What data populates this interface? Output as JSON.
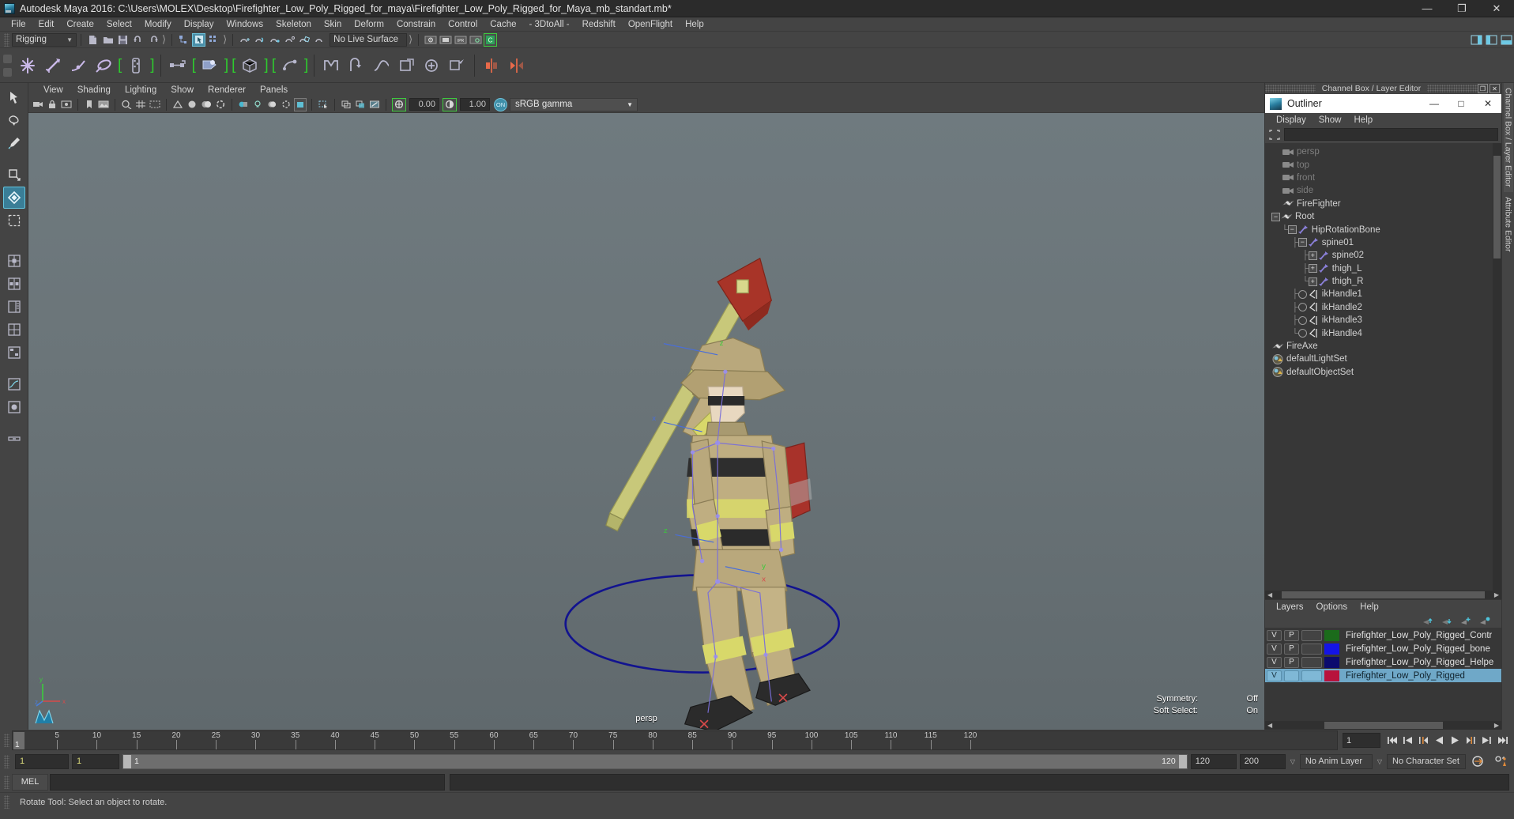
{
  "window": {
    "title": "Autodesk Maya 2016: C:\\Users\\MOLEX\\Desktop\\Firefighter_Low_Poly_Rigged_for_maya\\Firefighter_Low_Poly_Rigged_for_Maya_mb_standart.mb*",
    "minimize": "—",
    "maximize": "❐",
    "close": "✕"
  },
  "menubar": [
    "File",
    "Edit",
    "Create",
    "Select",
    "Modify",
    "Display",
    "Windows",
    "Skeleton",
    "Skin",
    "Deform",
    "Constrain",
    "Control",
    "Cache",
    "- 3DtoAll -",
    "Redshift",
    "OpenFlight",
    "Help"
  ],
  "toolbar": {
    "menuset": "Rigging",
    "live_surface": "No Live Surface"
  },
  "viewport_panel_menu": [
    "View",
    "Shading",
    "Lighting",
    "Show",
    "Renderer",
    "Panels"
  ],
  "viewport_toolbar": {
    "exposure_value": "0.00",
    "gamma_value": "1.00",
    "color_mode": "sRGB gamma",
    "color_mode_on": "ON"
  },
  "viewport": {
    "camera_label": "persp",
    "hud": [
      {
        "label": "Symmetry:",
        "value": "Off"
      },
      {
        "label": "Soft Select:",
        "value": "On"
      }
    ],
    "axis": {
      "x": "x",
      "y": "y",
      "z": "z"
    }
  },
  "channelbox_bar": {
    "title": "Channel Box / Layer Editor",
    "restore": "❐",
    "close": "✕"
  },
  "outliner": {
    "title": "Outliner",
    "minimize": "—",
    "maximize": "□",
    "close": "✕",
    "menu": [
      "Display",
      "Show",
      "Help"
    ],
    "search_value": "",
    "search_placeholder": "",
    "items": [
      {
        "label": "persp",
        "indent": 1,
        "icon": "camera-icon",
        "dim": true,
        "expander": "none",
        "line": "none"
      },
      {
        "label": "top",
        "indent": 1,
        "icon": "camera-icon",
        "dim": true,
        "expander": "none",
        "line": "none"
      },
      {
        "label": "front",
        "indent": 1,
        "icon": "camera-icon",
        "dim": true,
        "expander": "none",
        "line": "none"
      },
      {
        "label": "side",
        "indent": 1,
        "icon": "camera-icon",
        "dim": true,
        "expander": "none",
        "line": "none"
      },
      {
        "label": "FireFighter",
        "indent": 1,
        "icon": "mesh-icon",
        "dim": false,
        "expander": "none",
        "line": "none"
      },
      {
        "label": "Root",
        "indent": 0,
        "icon": "mesh-icon",
        "dim": false,
        "expander": "minus",
        "line": "none"
      },
      {
        "label": "HipRotationBone",
        "indent": 1,
        "icon": "joint-icon",
        "dim": false,
        "expander": "minus",
        "line": "corner"
      },
      {
        "label": "spine01",
        "indent": 2,
        "icon": "joint-icon",
        "dim": false,
        "expander": "minus",
        "line": "tee"
      },
      {
        "label": "spine02",
        "indent": 3,
        "icon": "joint-icon",
        "dim": false,
        "expander": "plus",
        "line": "tee"
      },
      {
        "label": "thigh_L",
        "indent": 3,
        "icon": "joint-icon",
        "dim": false,
        "expander": "plus",
        "line": "tee"
      },
      {
        "label": "thigh_R",
        "indent": 3,
        "icon": "joint-icon",
        "dim": false,
        "expander": "plus",
        "line": "corner"
      },
      {
        "label": "ikHandle1",
        "indent": 2,
        "icon": "ikhandle-icon",
        "dim": false,
        "expander": "dot",
        "line": "tee"
      },
      {
        "label": "ikHandle2",
        "indent": 2,
        "icon": "ikhandle-icon",
        "dim": false,
        "expander": "dot",
        "line": "tee"
      },
      {
        "label": "ikHandle3",
        "indent": 2,
        "icon": "ikhandle-icon",
        "dim": false,
        "expander": "dot",
        "line": "tee"
      },
      {
        "label": "ikHandle4",
        "indent": 2,
        "icon": "ikhandle-icon",
        "dim": false,
        "expander": "dot",
        "line": "corner"
      },
      {
        "label": "FireAxe",
        "indent": 0,
        "icon": "mesh-icon",
        "dim": false,
        "expander": "none",
        "line": "none"
      },
      {
        "label": "defaultLightSet",
        "indent": 0,
        "icon": "set-icon",
        "dim": false,
        "expander": "none",
        "line": "none"
      },
      {
        "label": "defaultObjectSet",
        "indent": 0,
        "icon": "set-icon",
        "dim": false,
        "expander": "none",
        "line": "none"
      }
    ]
  },
  "layer_editor": {
    "menu": [
      "Layers",
      "Options",
      "Help"
    ],
    "layers": [
      {
        "visibility": "V",
        "playback": "P",
        "third": "",
        "color": "#1b6b1b",
        "name": "Firefighter_Low_Poly_Rigged_Contr",
        "selected": false
      },
      {
        "visibility": "V",
        "playback": "P",
        "third": "",
        "color": "#1414e6",
        "name": "Firefighter_Low_Poly_Rigged_bone",
        "selected": false
      },
      {
        "visibility": "V",
        "playback": "P",
        "third": "",
        "color": "#0b0b6e",
        "name": "Firefighter_Low_Poly_Rigged_Helpe",
        "selected": false
      },
      {
        "visibility": "V",
        "playback": "",
        "third": "",
        "color": "#b8123c",
        "name": "Firefighter_Low_Poly_Rigged",
        "selected": true
      }
    ]
  },
  "side_tabs": [
    {
      "label": "Channel Box / Layer Editor",
      "active": true
    },
    {
      "label": "Attribute Editor",
      "active": false
    }
  ],
  "timeline": {
    "ticks": [
      5,
      10,
      15,
      20,
      25,
      30,
      35,
      40,
      45,
      50,
      55,
      60,
      65,
      70,
      75,
      80,
      85,
      90,
      95,
      100,
      105,
      110,
      115,
      120
    ],
    "start": 1,
    "end": 120,
    "current_frame": "1",
    "current_frame_field": "1"
  },
  "range": {
    "anim_start": "1",
    "anim_end": "1",
    "range_start": "1",
    "range_end": "120",
    "playback_end": "120",
    "scene_end": "200",
    "anim_layer": "No Anim Layer",
    "character_set": "No Character Set"
  },
  "command_line": {
    "language": "MEL",
    "value": ""
  },
  "statusbar": {
    "message": "Rotate Tool: Select an object to rotate."
  },
  "colors": {
    "accent_blue": "#4a8fa8",
    "green_highlight": "#3ecb3e",
    "selection_blue": "#6fa8c8",
    "panel_bg": "#444444",
    "tree_bg": "#373737"
  }
}
